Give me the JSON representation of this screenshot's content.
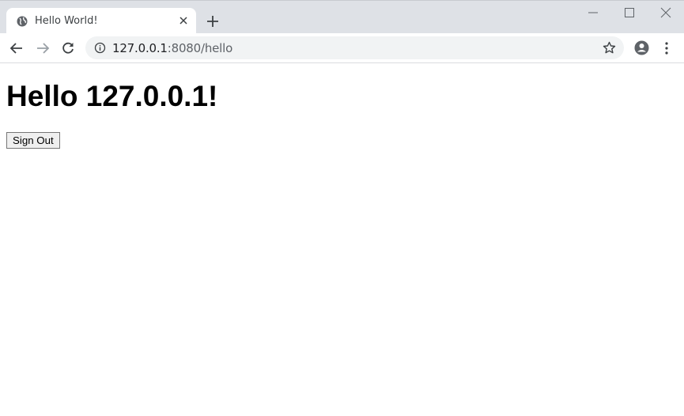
{
  "browser": {
    "tab": {
      "title": "Hello World!",
      "favicon": "globe-icon"
    },
    "address": {
      "host": "127.0.0.1",
      "rest": ":8080/hello"
    },
    "icons": [
      "back-icon",
      "forward-icon",
      "reload-icon",
      "info-icon",
      "star-icon",
      "account-icon",
      "menu-icon",
      "minimize-icon",
      "maximize-icon",
      "close-icon",
      "new-tab-icon"
    ]
  },
  "page": {
    "heading": "Hello 127.0.0.1!",
    "signout_label": "Sign Out"
  }
}
